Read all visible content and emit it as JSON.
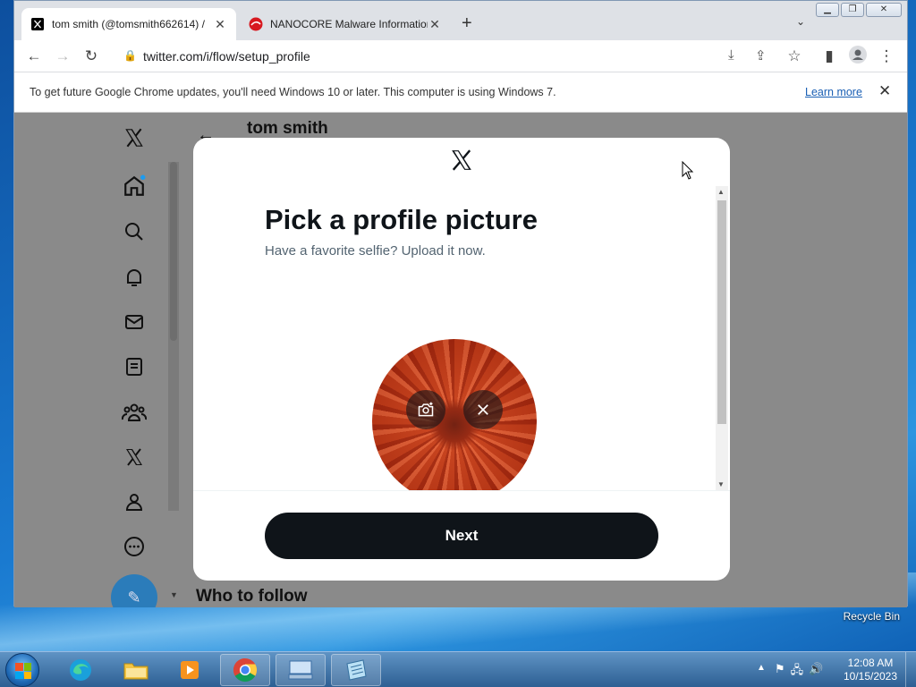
{
  "browser": {
    "tabs": [
      {
        "title": "tom smith (@tomsmith662614) /",
        "active": true,
        "favicon": "x-logo-icon"
      },
      {
        "title": "NANOCORE Malware Information",
        "active": false,
        "favicon": "trendmicro-icon"
      }
    ],
    "new_tab_label": "+",
    "address": "twitter.com/i/flow/setup_profile",
    "infobar": {
      "message": "To get future Google Chrome updates, you'll need Windows 10 or later. This computer is using Windows 7.",
      "link": "Learn more"
    }
  },
  "page": {
    "profile_name": "tom smith",
    "who_to_follow": "Who to follow",
    "nav_icons": [
      "x-logo-icon",
      "home-icon",
      "search-icon",
      "notifications-icon",
      "messages-icon",
      "lists-icon",
      "communities-icon",
      "premium-icon",
      "profile-icon",
      "more-icon"
    ]
  },
  "modal": {
    "title": "Pick a profile picture",
    "subtitle": "Have a favorite selfie? Upload it now.",
    "next_button": "Next"
  },
  "desktop": {
    "recycle_bin": "Recycle Bin"
  },
  "taskbar": {
    "time": "12:08 AM",
    "date": "10/15/2023"
  },
  "colors": {
    "accent": "#1d9bf0",
    "button_dark": "#0f1419",
    "overlay": "#8a8a8a"
  }
}
